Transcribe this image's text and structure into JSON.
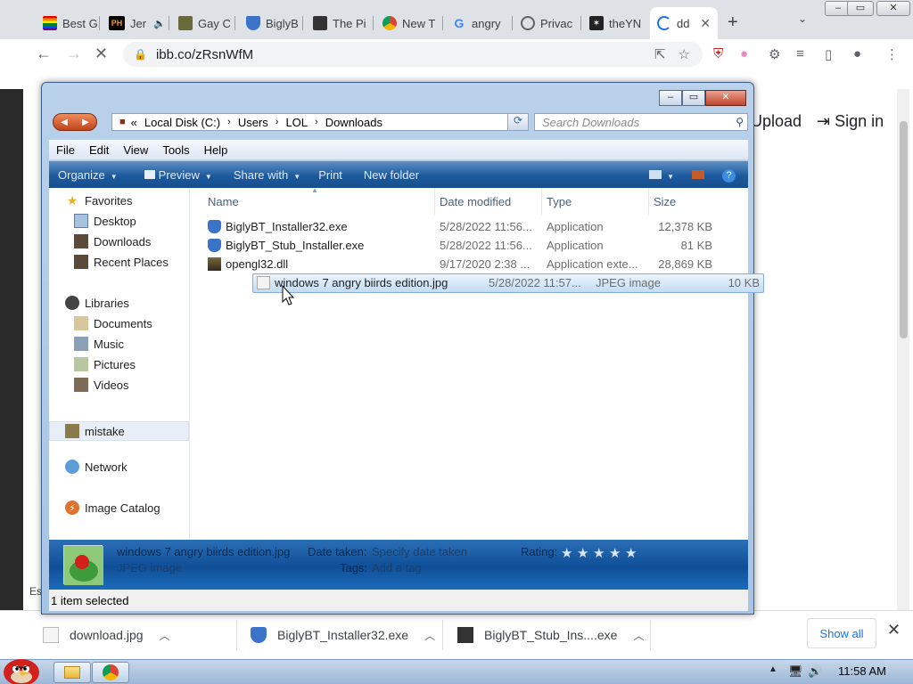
{
  "browser": {
    "tabs": [
      {
        "label": "Best G",
        "icon": "pride-flag-icon"
      },
      {
        "label": "Jer",
        "icon": "ph-icon",
        "ph_text": "PH"
      },
      {
        "label": "Gay C",
        "icon": "soldier-icon"
      },
      {
        "label": "BiglyB",
        "icon": "biglybt-icon"
      },
      {
        "label": "The Pi",
        "icon": "pirate-icon"
      },
      {
        "label": "New T",
        "icon": "chrome-icon"
      },
      {
        "label": "angry",
        "icon": "google-icon"
      },
      {
        "label": "Privac",
        "icon": "globe-icon"
      },
      {
        "label": "theYN",
        "icon": "star-logo-icon"
      },
      {
        "label": "dd",
        "icon": "loading-spinner-icon"
      }
    ],
    "url": "ibb.co/zRsnWfM",
    "page": {
      "upload_label": "Upload",
      "signin_label": "Sign in",
      "partial_text": "Es"
    },
    "downloads": [
      {
        "name": "download.jpg"
      },
      {
        "name": "BiglyBT_Installer32.exe"
      },
      {
        "name": "BiglyBT_Stub_Ins....exe"
      }
    ],
    "show_all_label": "Show all"
  },
  "explorer": {
    "path": [
      "Local Disk (C:)",
      "Users",
      "LOL",
      "Downloads"
    ],
    "path_prefix": "«",
    "search_placeholder": "Search Downloads",
    "menu": [
      "File",
      "Edit",
      "View",
      "Tools",
      "Help"
    ],
    "commands": {
      "organize": "Organize",
      "preview": "Preview",
      "share_with": "Share with",
      "print": "Print",
      "new_folder": "New folder"
    },
    "nav": {
      "favorites": "Favorites",
      "desktop": "Desktop",
      "downloads": "Downloads",
      "recent_places": "Recent Places",
      "libraries": "Libraries",
      "documents": "Documents",
      "music": "Music",
      "pictures": "Pictures",
      "videos": "Videos",
      "mistake": "mistake",
      "network": "Network",
      "image_catalog": "Image Catalog"
    },
    "columns": {
      "name": "Name",
      "date": "Date modified",
      "type": "Type",
      "size": "Size"
    },
    "files": [
      {
        "name": "BiglyBT_Installer32.exe",
        "date": "5/28/2022 11:56...",
        "type": "Application",
        "size": "12,378 KB"
      },
      {
        "name": "BiglyBT_Stub_Installer.exe",
        "date": "5/28/2022 11:56...",
        "type": "Application",
        "size": "81 KB"
      },
      {
        "name": "opengl32.dll",
        "date": "9/17/2020 2:38 ...",
        "type": "Application exte...",
        "size": "28,869 KB"
      },
      {
        "name": "windows 7 angry biirds edition.jpg",
        "date": "5/28/2022 11:57...",
        "type": "JPEG image",
        "size": "10 KB"
      }
    ],
    "details": {
      "filename": "windows 7 angry biirds edition.jpg",
      "filetype": "JPEG image",
      "date_taken_label": "Date taken:",
      "date_taken_value": "Specify date taken",
      "tags_label": "Tags:",
      "tags_value": "Add a tag",
      "rating_label": "Rating:",
      "rating_stars": 0
    },
    "status": "1 item selected"
  },
  "taskbar": {
    "clock": "11:58 AM"
  },
  "colors": {
    "accent": "#1a73e8",
    "win7_command_bar": "#1c5a9e",
    "selection": "#c3dcf4"
  }
}
